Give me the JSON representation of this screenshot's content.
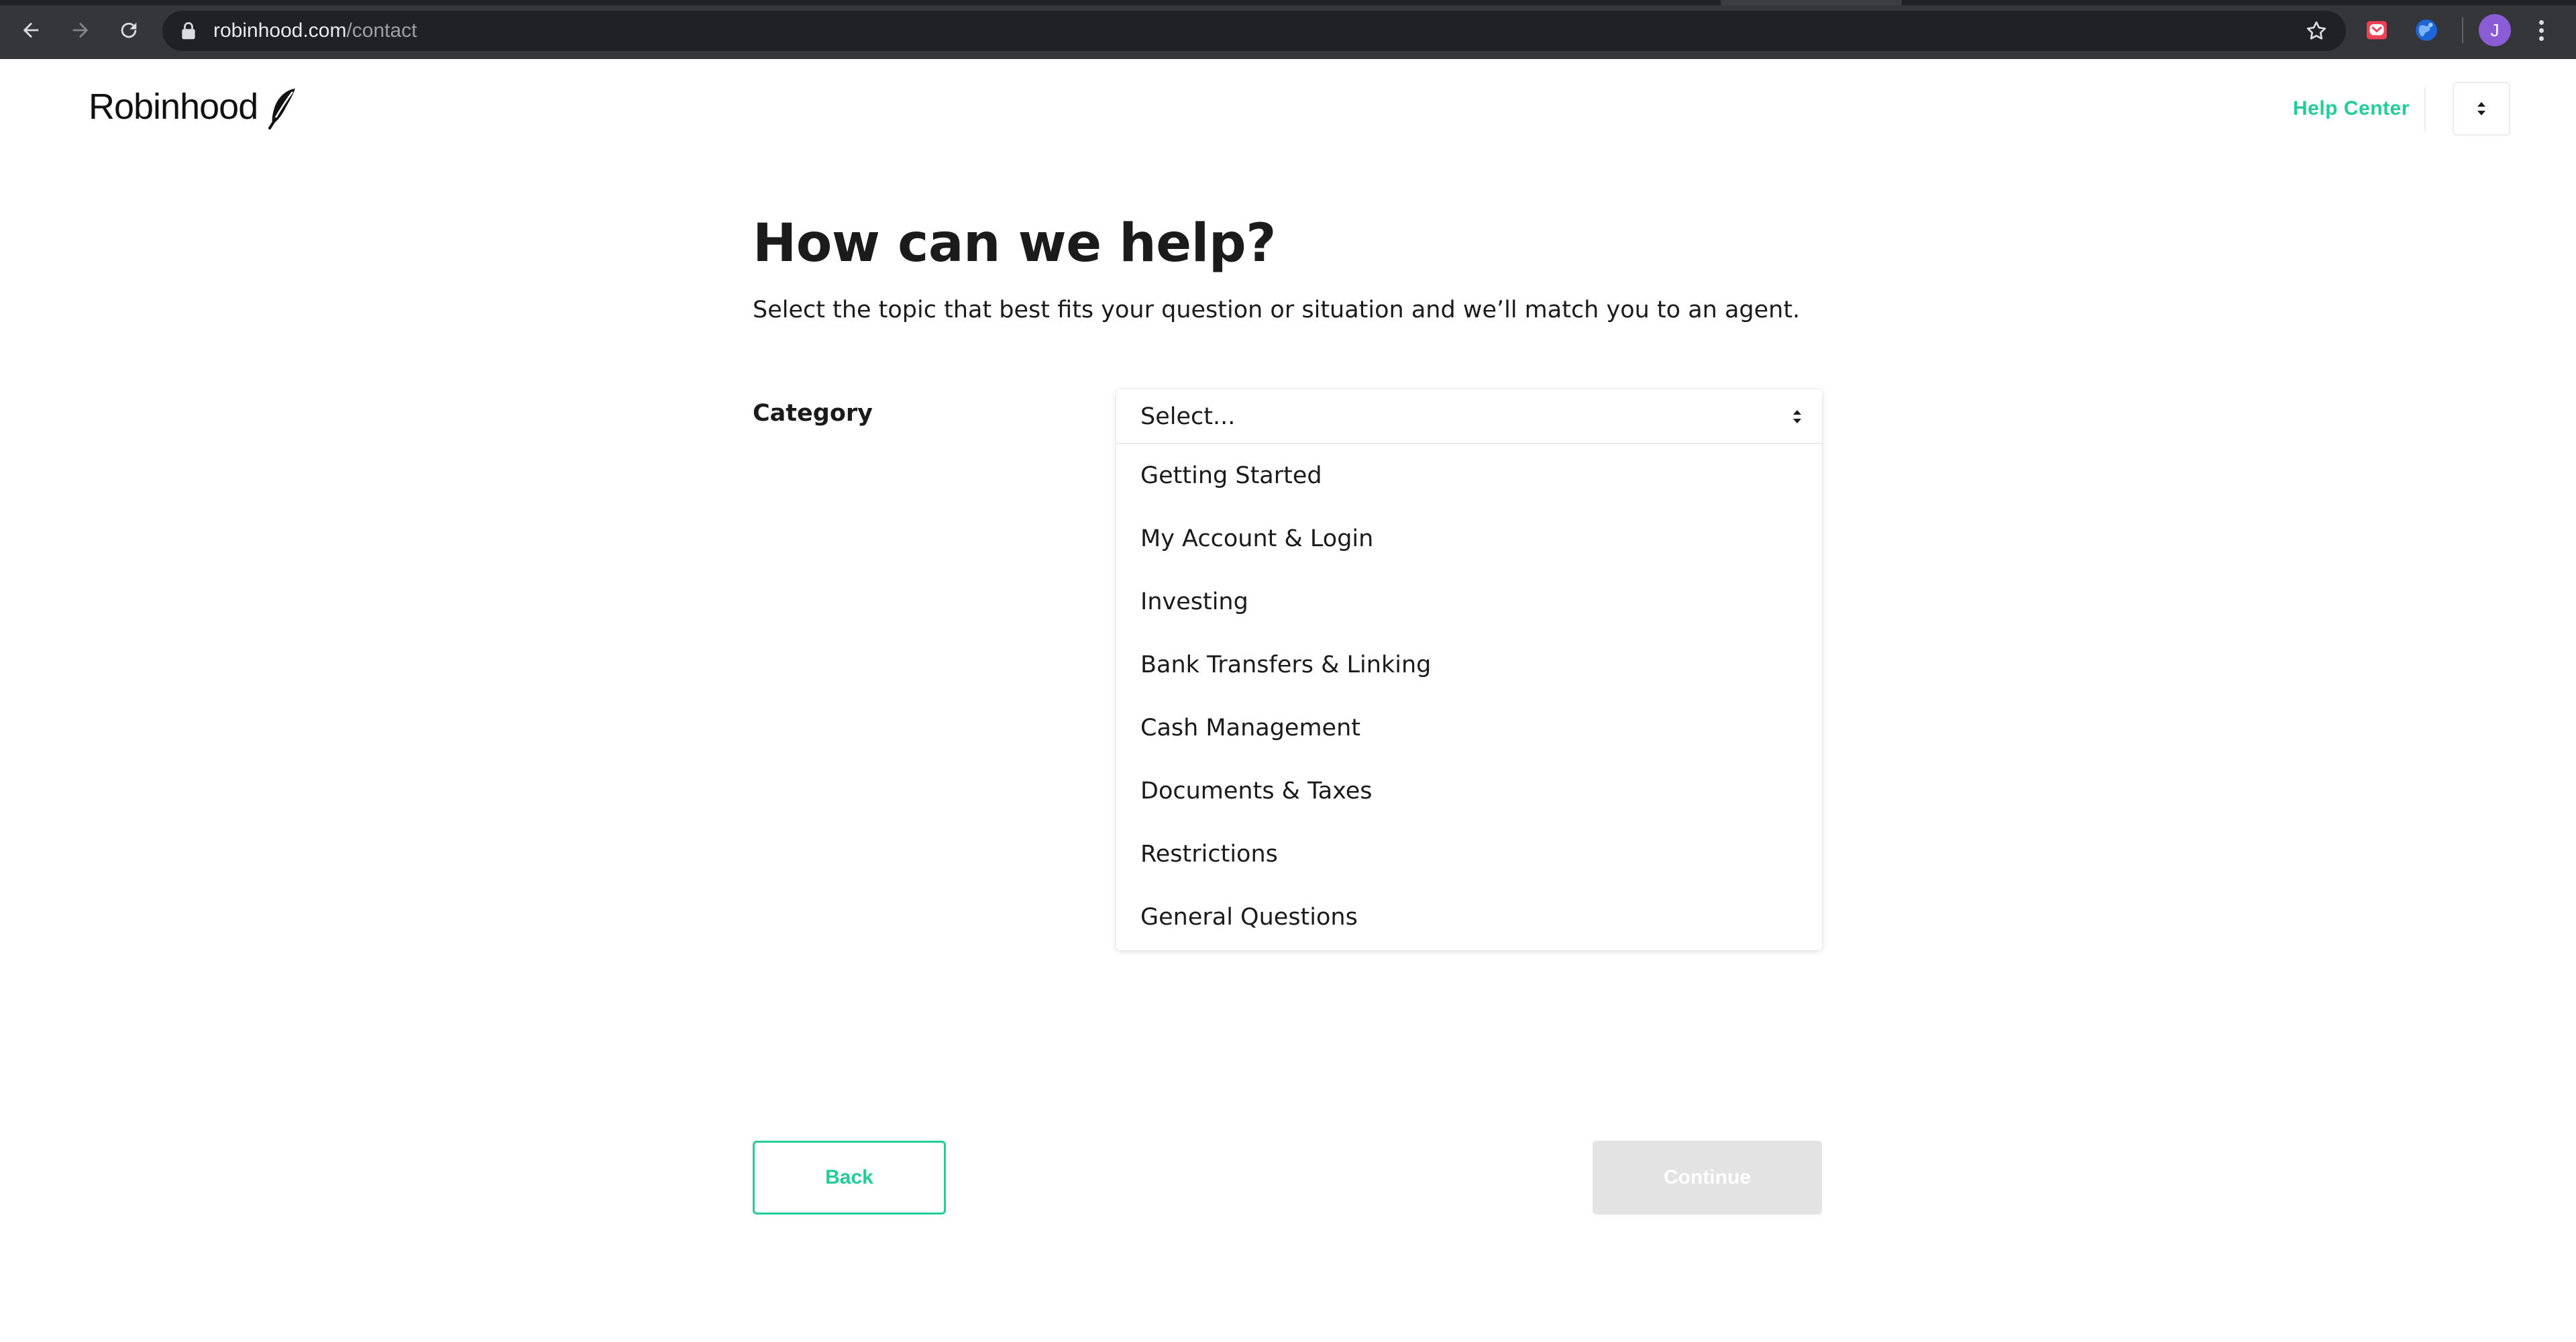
{
  "browser": {
    "url_host": "robinhood.com",
    "url_path": "/contact",
    "avatar_initial": "J"
  },
  "header": {
    "logo_text": "Robinhood",
    "help_center_label": "Help Center"
  },
  "main": {
    "title": "How can we help?",
    "subtitle": "Select the topic that best fits your question or situation and we’ll match you to an agent.",
    "category_label": "Category",
    "select": {
      "value": "Select...",
      "options": [
        "Getting Started",
        "My Account & Login",
        "Investing",
        "Bank Transfers & Linking",
        "Cash Management",
        "Documents & Taxes",
        "Restrictions",
        "General Questions"
      ]
    },
    "back_label": "Back",
    "continue_label": "Continue"
  },
  "colors": {
    "accent": "#21ce99",
    "chrome": "#35363a",
    "omnibox": "#202124",
    "disabled_button": "#e3e3e3",
    "avatar": "#8a5cd6"
  },
  "icons": {
    "back": "arrow-left-icon",
    "forward": "arrow-right-icon",
    "reload": "reload-icon",
    "lock": "lock-icon",
    "bookmark": "star-icon",
    "extension_1": "pocket-icon",
    "extension_2": "globe-icon",
    "menu": "kebab-icon",
    "logo": "feather-icon",
    "select_caret": "chevron-updown-icon"
  }
}
